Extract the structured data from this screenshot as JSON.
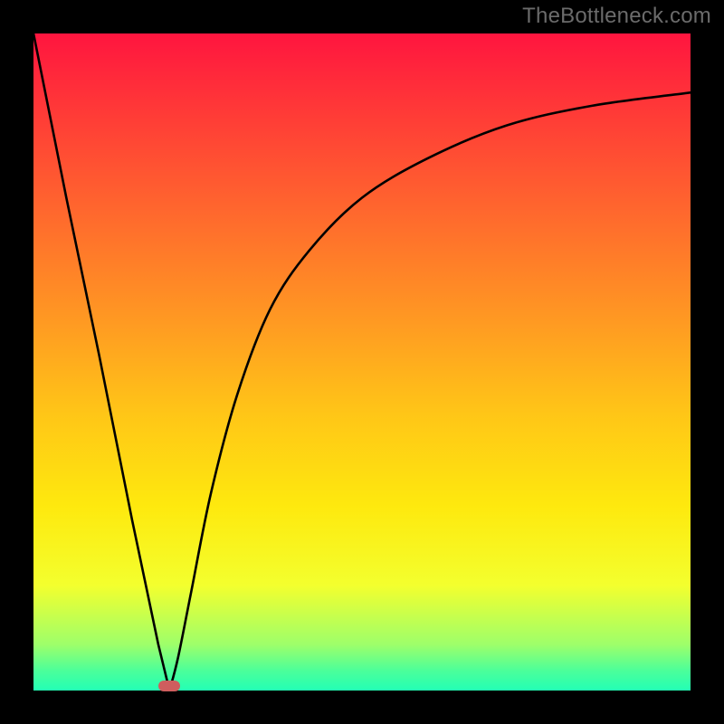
{
  "watermark_text": "TheBottleneck.com",
  "chart_data": {
    "type": "line",
    "title": "",
    "xlabel": "",
    "ylabel": "",
    "xlim": [
      0,
      100
    ],
    "ylim": [
      0,
      100
    ],
    "x_min_vertex": 20.7,
    "indicator": {
      "x": 20.7,
      "y": 0,
      "color": "#cf5e5e"
    },
    "axes_visible": false,
    "grid": false,
    "background_gradient": {
      "stops": [
        {
          "pos": 0,
          "color": "#ff153f"
        },
        {
          "pos": 12,
          "color": "#ff3a37"
        },
        {
          "pos": 28,
          "color": "#ff6a2d"
        },
        {
          "pos": 44,
          "color": "#ff9a22"
        },
        {
          "pos": 58,
          "color": "#ffc617"
        },
        {
          "pos": 72,
          "color": "#fee90e"
        },
        {
          "pos": 84,
          "color": "#f3ff2e"
        },
        {
          "pos": 93,
          "color": "#9eff6a"
        },
        {
          "pos": 97,
          "color": "#4bff9a"
        },
        {
          "pos": 100,
          "color": "#23ffb5"
        }
      ]
    },
    "series": [
      {
        "name": "bottleneck-curve",
        "description": "V-shaped curve: steep linear descent from top-left to minimum at x≈20.7, then concave rise approaching ~90% on the right edge.",
        "points": [
          {
            "x": 0.0,
            "y": 100.0
          },
          {
            "x": 5.0,
            "y": 75.0
          },
          {
            "x": 10.0,
            "y": 51.0
          },
          {
            "x": 15.0,
            "y": 26.0
          },
          {
            "x": 19.0,
            "y": 7.0
          },
          {
            "x": 20.7,
            "y": 0.0
          },
          {
            "x": 22.0,
            "y": 5.0
          },
          {
            "x": 24.0,
            "y": 15.0
          },
          {
            "x": 27.0,
            "y": 30.0
          },
          {
            "x": 31.0,
            "y": 45.0
          },
          {
            "x": 36.0,
            "y": 58.0
          },
          {
            "x": 42.0,
            "y": 67.0
          },
          {
            "x": 50.0,
            "y": 75.0
          },
          {
            "x": 60.0,
            "y": 81.0
          },
          {
            "x": 72.0,
            "y": 86.0
          },
          {
            "x": 85.0,
            "y": 89.0
          },
          {
            "x": 100.0,
            "y": 91.0
          }
        ]
      }
    ]
  }
}
